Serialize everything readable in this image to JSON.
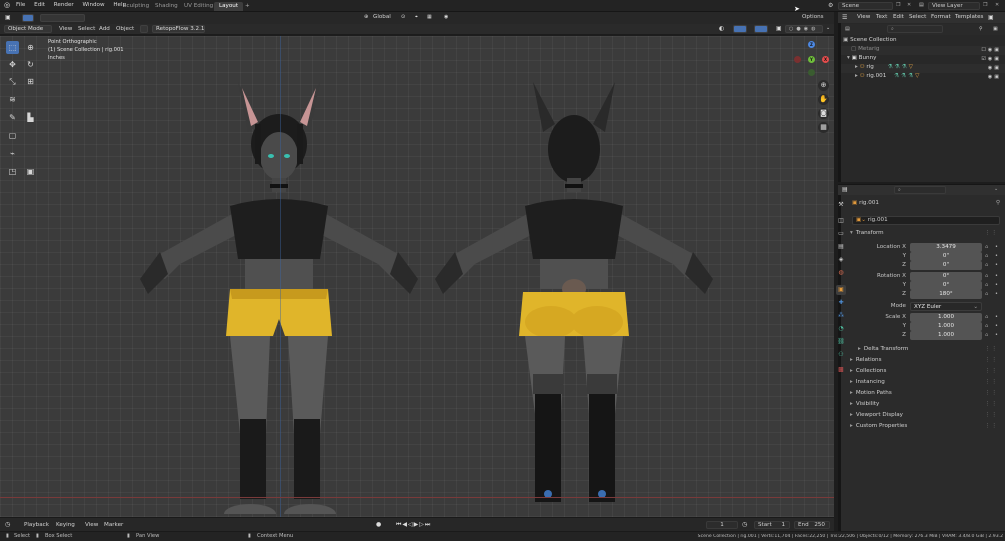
{
  "menubar": {
    "items": [
      "File",
      "Edit",
      "Render",
      "Window",
      "Help"
    ],
    "workspaces": [
      "Sculpting",
      "Shading",
      "UV Editing",
      "Layout"
    ],
    "active_workspace": "Layout",
    "add_tab": "+",
    "scene_label": "Scene",
    "view_layer_label": "View Layer"
  },
  "viewport_header": {
    "transform_orientation": "Global",
    "options_label": "Options"
  },
  "viewport_header2": {
    "mode": "Object Mode",
    "menus": [
      "View",
      "Select",
      "Add",
      "Object"
    ],
    "addon": "RetopoFlow 3.2.1"
  },
  "overlay_text": {
    "line1": "Point Orthographic",
    "line2": "(1) Scene Collection | rig.001",
    "line3": "Inches"
  },
  "timeline": {
    "menus": [
      "Playback",
      "Keying",
      "View",
      "Marker"
    ],
    "current_frame": "1",
    "start_label": "Start",
    "start_value": "1",
    "end_label": "End",
    "end_value": "250"
  },
  "statusbar": {
    "items": [
      "Select",
      "Box Select",
      "Pan View",
      "Context Menu"
    ],
    "stats": "Scene Collection | rig.001 | Verts:11,704 | Faces:22,250 | Tris:22,506 | Objects:0/12 | Memory: 276.3 MiB | VRAM: 3.4/8.0 GiB | 2.93.2"
  },
  "outliner": {
    "menus": [
      "View",
      "Text",
      "Edit",
      "Select",
      "Format",
      "Templates"
    ],
    "rows": [
      {
        "label": "Scene Collection",
        "indent": 0
      },
      {
        "label": "Metarig",
        "indent": 1
      },
      {
        "label": "Bunny",
        "indent": 1
      },
      {
        "label": "rig",
        "indent": 2
      },
      {
        "label": "rig.001",
        "indent": 2
      }
    ]
  },
  "properties": {
    "object_name": "rig.001",
    "object_name_field": "rig.001",
    "transform_label": "Transform",
    "location_x_label": "Location X",
    "location": [
      "3.3479",
      "0\"",
      "0\""
    ],
    "rotation_x_label": "Rotation X",
    "rotation": [
      "0°",
      "0°",
      "180°"
    ],
    "mode_label": "Mode",
    "mode_value": "XYZ Euler",
    "scale_x_label": "Scale X",
    "scale": [
      "1.000",
      "1.000",
      "1.000"
    ],
    "y_label": "Y",
    "z_label": "Z",
    "delta_transform_label": "Delta Transform",
    "panels": [
      "Relations",
      "Collections",
      "Instancing",
      "Motion Paths",
      "Visibility",
      "Viewport Display",
      "Custom Properties"
    ]
  },
  "colors": {
    "accent": "#4772b3",
    "viewport_bg": "#3b3b3b",
    "gizmo_x": "#e34c4c",
    "gizmo_y": "#6ebd3a",
    "gizmo_z": "#4c88e3",
    "shorts_yellow": "#e0b52a"
  }
}
